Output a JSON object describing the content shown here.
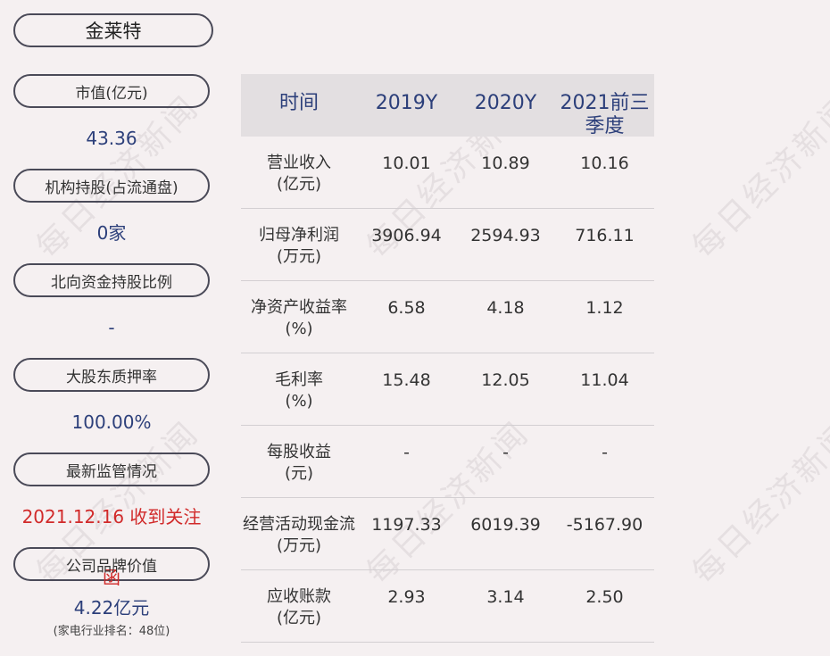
{
  "company": "金莱特",
  "left_metrics": [
    {
      "label": "市值(亿元)",
      "value": "43.36"
    },
    {
      "label": "机构持股(占流通盘)",
      "value": "0家"
    },
    {
      "label": "北向资金持股比例",
      "value": "-"
    },
    {
      "label": "大股东质押率",
      "value": "100.00%"
    },
    {
      "label": "最新监管情况",
      "value": "2021.12.16 收到关注函"
    },
    {
      "label": "公司品牌价值",
      "value": "4.22亿元",
      "note": "(家电行业排名：48位)"
    }
  ],
  "table": {
    "headers": [
      "时间",
      "2019Y",
      "2020Y",
      "2021前三季度"
    ],
    "rows": [
      {
        "label": "营业收入",
        "unit": "(亿元)",
        "values": [
          "10.01",
          "10.89",
          "10.16"
        ]
      },
      {
        "label": "归母净利润",
        "unit": "(万元)",
        "values": [
          "3906.94",
          "2594.93",
          "716.11"
        ]
      },
      {
        "label": "净资产收益率",
        "unit": "(%)",
        "values": [
          "6.58",
          "4.18",
          "1.12"
        ]
      },
      {
        "label": "毛利率",
        "unit": "(%)",
        "values": [
          "15.48",
          "12.05",
          "11.04"
        ]
      },
      {
        "label": "每股收益",
        "unit": "(元)",
        "values": [
          "-",
          "-",
          "-"
        ]
      },
      {
        "label": "经营活动现金流",
        "unit": "(万元)",
        "values": [
          "1197.33",
          "6019.39",
          "-5167.90"
        ]
      },
      {
        "label": "应收账款",
        "unit": "(亿元)",
        "values": [
          "2.93",
          "3.14",
          "2.50"
        ]
      }
    ]
  },
  "watermark": "每日经济新闻",
  "colors": {
    "value_blue": "#2c3f7a",
    "alert_red": "#d12a2a",
    "header_bg": "#e3dfe1",
    "page_bg": "#f5f0f1"
  }
}
